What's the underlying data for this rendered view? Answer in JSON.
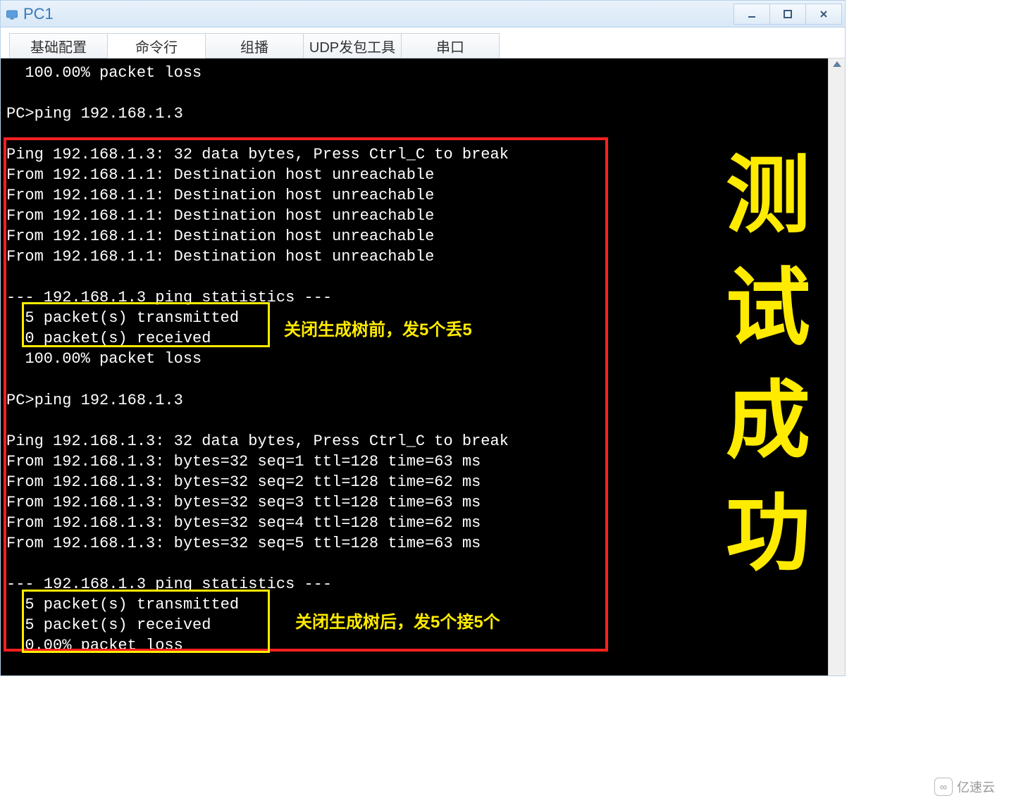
{
  "window": {
    "title": "PC1"
  },
  "tabs": [
    {
      "label": "基础配置",
      "active": false
    },
    {
      "label": "命令行",
      "active": true
    },
    {
      "label": "组播",
      "active": false
    },
    {
      "label": "UDP发包工具",
      "active": false
    },
    {
      "label": "串口",
      "active": false
    }
  ],
  "terminal": {
    "lines": [
      "  100.00% packet loss",
      "",
      "PC>ping 192.168.1.3",
      "",
      "Ping 192.168.1.3: 32 data bytes, Press Ctrl_C to break",
      "From 192.168.1.1: Destination host unreachable",
      "From 192.168.1.1: Destination host unreachable",
      "From 192.168.1.1: Destination host unreachable",
      "From 192.168.1.1: Destination host unreachable",
      "From 192.168.1.1: Destination host unreachable",
      "",
      "--- 192.168.1.3 ping statistics ---",
      "  5 packet(s) transmitted",
      "  0 packet(s) received",
      "  100.00% packet loss",
      "",
      "PC>ping 192.168.1.3",
      "",
      "Ping 192.168.1.3: 32 data bytes, Press Ctrl_C to break",
      "From 192.168.1.3: bytes=32 seq=1 ttl=128 time=63 ms",
      "From 192.168.1.3: bytes=32 seq=2 ttl=128 time=62 ms",
      "From 192.168.1.3: bytes=32 seq=3 ttl=128 time=63 ms",
      "From 192.168.1.3: bytes=32 seq=4 ttl=128 time=62 ms",
      "From 192.168.1.3: bytes=32 seq=5 ttl=128 time=63 ms",
      "",
      "--- 192.168.1.3 ping statistics ---",
      "  5 packet(s) transmitted",
      "  5 packet(s) received",
      "  0.00% packet loss"
    ]
  },
  "annotations": {
    "note1": "关闭生成树前，发5个丢5",
    "note2": "关闭生成树后，发5个接5个",
    "big": "测试成功"
  },
  "watermark": "亿速云"
}
